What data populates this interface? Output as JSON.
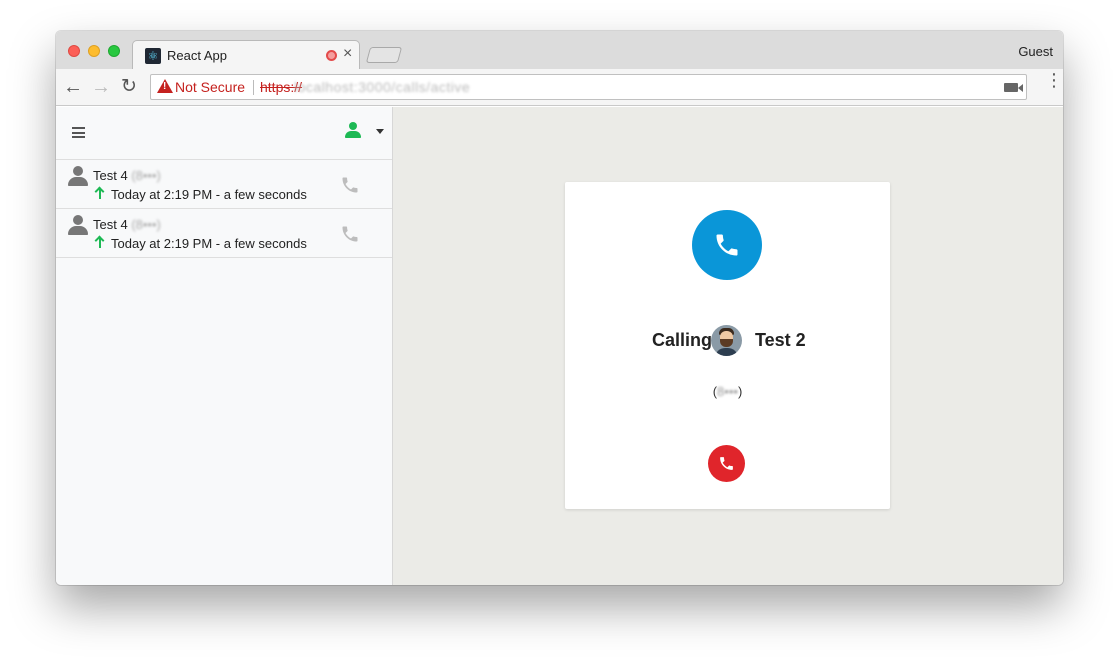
{
  "browser": {
    "tab_title": "React App",
    "tab_favicon": "react-icon",
    "tab_close_glyph": "×",
    "profile_label": "Guest",
    "security_label": "Not Secure",
    "url_protocol": "https://",
    "url_rest": "localhost:3000/calls/active",
    "colors": {
      "insecure": "#c5221f",
      "tabstrip": "#dcdcdc"
    }
  },
  "sidebar": {
    "menu_icon": "hamburger-icon",
    "status_icon": "user-online-icon",
    "status_color": "#1db954",
    "calls": [
      {
        "name": "Test 4",
        "number_masked": "(8•••)",
        "direction": "outgoing",
        "time": "Today at 2:19 PM - a few seconds"
      },
      {
        "name": "Test 4",
        "number_masked": "(8•••)",
        "direction": "outgoing",
        "time": "Today at 2:19 PM - a few seconds"
      }
    ]
  },
  "call": {
    "status_label": "Calling",
    "contact_name": "Test 2",
    "contact_number_masked": "8•••",
    "accent": "#0a96d8",
    "hangup_color": "#e0252b"
  }
}
